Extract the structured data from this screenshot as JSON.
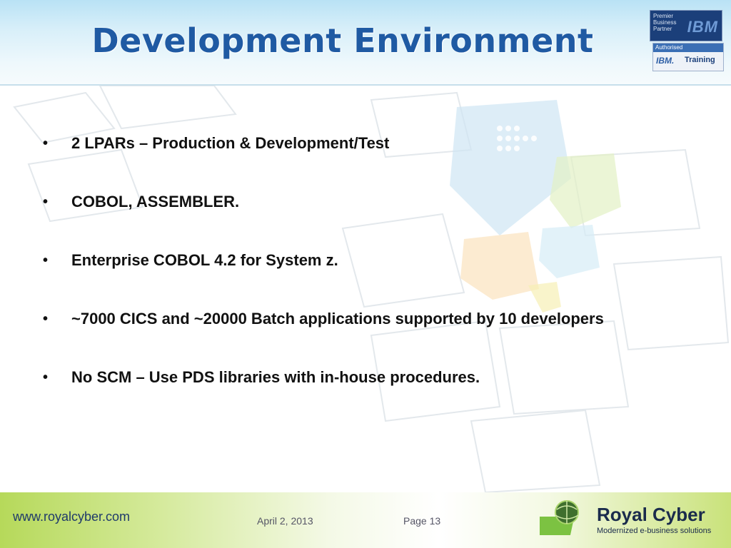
{
  "slide": {
    "title": "Development Environment",
    "bullets": [
      "2 LPARs – Production & Development/Test",
      "COBOL, ASSEMBLER.",
      "Enterprise COBOL 4.2  for System z.",
      "~7000 CICS and ~20000 Batch applications supported by 10 developers",
      "No SCM – Use PDS libraries with in-house procedures."
    ],
    "bullet_symbol": "•"
  },
  "ibm_badge": {
    "line1": "Premier",
    "line2": "Business",
    "line3": "Partner",
    "wordmark": "IBM",
    "authorised": "Authorised",
    "small_wordmark": "IBM.",
    "training": "Training"
  },
  "footer": {
    "url": "www.royalcyber.com",
    "date": "April 2, 2013",
    "page": "Page 13",
    "company": "Royal Cyber",
    "tagline": "Modernized e-business solutions"
  },
  "colors": {
    "title": "#1f5aa3",
    "header_bg": "#c9e9f7",
    "footer_green": "#b6d95a",
    "text": "#111111"
  }
}
